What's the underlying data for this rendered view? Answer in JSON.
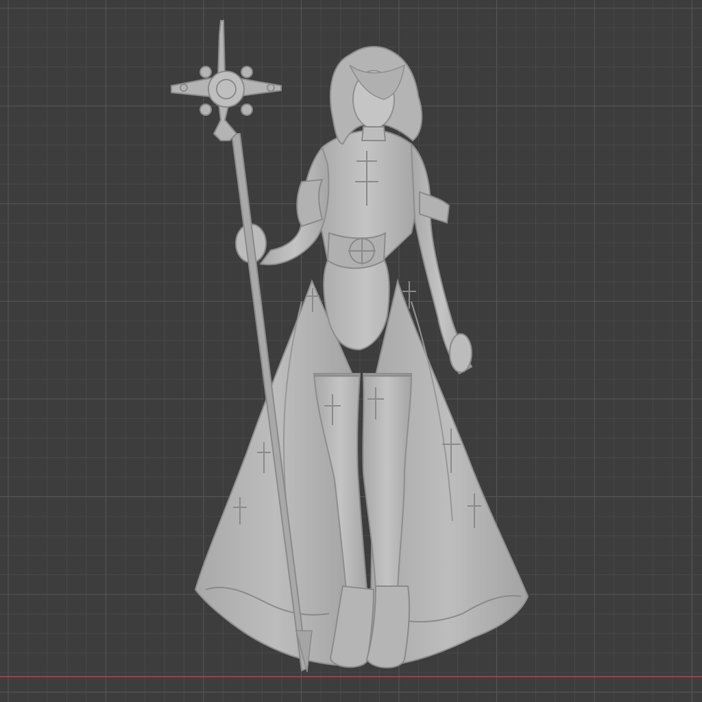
{
  "viewport": {
    "type": "3d-viewport",
    "shading": "solid",
    "background_color": "#3d3d3d",
    "grid_minor_color": "#484848",
    "grid_major_color": "#575757",
    "x_axis_color": "#a84a52",
    "grid_visible": true
  },
  "model": {
    "object": "sculpted-figure",
    "color": "#b7b7b7",
    "shadow_color": "#8f8f8f",
    "highlight_color": "#d2d2d2"
  }
}
